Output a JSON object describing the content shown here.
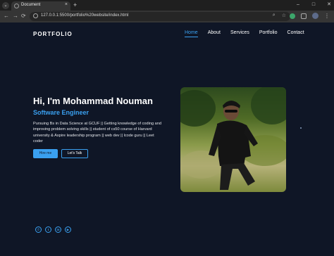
{
  "browser": {
    "tab_title": "Document",
    "tab_close": "×",
    "new_tab": "+",
    "url": "127.0.0.1:5500/portfolio%20website/index.html",
    "controls": {
      "minimize": "–",
      "maximize": "□",
      "close": "✕"
    },
    "nav": {
      "back": "←",
      "forward": "→",
      "reload": "⟳"
    },
    "omni_icons": {
      "zoom": "⌕",
      "bookmark": "☆"
    }
  },
  "site": {
    "logo": "PORTFOLIO",
    "nav": [
      "Home",
      "About",
      "Services",
      "Portfolio",
      "Contact"
    ],
    "active_nav": "Home"
  },
  "hero": {
    "title": "Hi, I'm Mohammad Nouman",
    "role": "Software Engineer",
    "description": "Pursuing Bs in Data Science at GCUF || Getting knowledge of coding and improving problem solving skills || student of cs50 course of Harvard university & Aspire leadership program || web dev || lcode guru || Leet coder",
    "hire_button": "Hire me",
    "talk_button": "Let's Talk"
  },
  "socials": [
    {
      "name": "whatsapp-icon",
      "glyph": "✆"
    },
    {
      "name": "twitter-icon",
      "glyph": "t"
    },
    {
      "name": "linkedin-icon",
      "glyph": "in"
    },
    {
      "name": "youtube-icon",
      "glyph": "▶"
    }
  ],
  "colors": {
    "background": "#0f1626",
    "accent": "#3aa0f0"
  }
}
